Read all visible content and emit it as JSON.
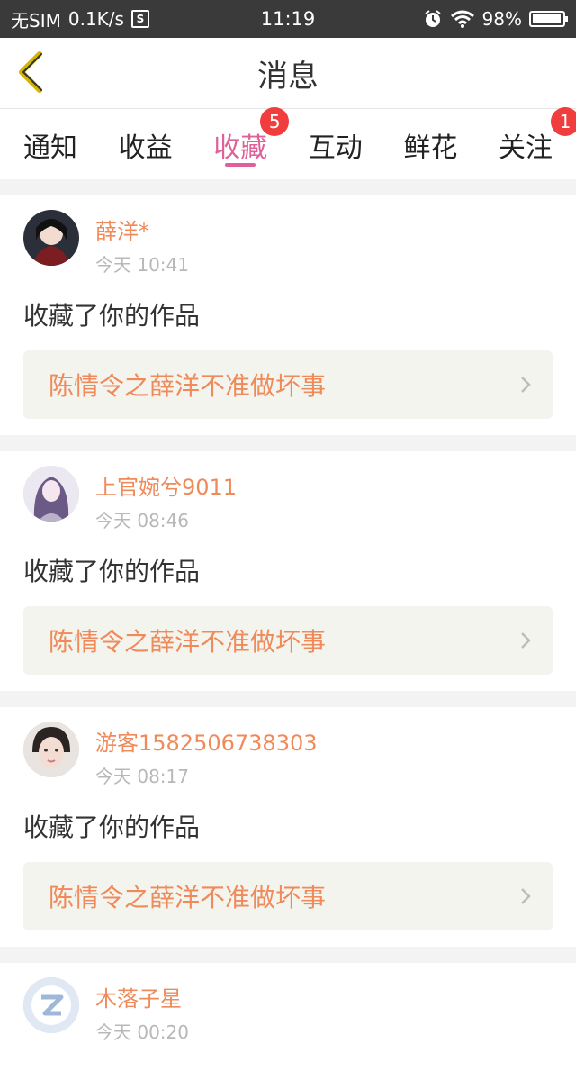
{
  "status_bar": {
    "carrier": "无SIM",
    "speed": "0.1K/s",
    "sim_icon_letter": "S",
    "time": "11:19",
    "battery": "98%",
    "battery_level": 0.98,
    "icons": [
      "alarm-icon",
      "wifi-icon",
      "battery-icon"
    ]
  },
  "header": {
    "title": "消息",
    "back_icon": "chevron-left-icon",
    "accent": "#d4b400"
  },
  "tabs": [
    {
      "label": "通知",
      "badge": ""
    },
    {
      "label": "收益",
      "badge": ""
    },
    {
      "label": "收藏",
      "badge": "5"
    },
    {
      "label": "互动",
      "badge": ""
    },
    {
      "label": "鲜花",
      "badge": ""
    },
    {
      "label": "关注",
      "badge": "1"
    }
  ],
  "active_tab": "收藏",
  "colors": {
    "accent_pink": "#e0609a",
    "name_orange": "#ef8a5a",
    "badge_red": "#f03e3e"
  },
  "messages": [
    {
      "name": "薛洋*",
      "time": "今天 10:41",
      "action": "收藏了你的作品",
      "work": "陈情令之薛洋不准做坏事"
    },
    {
      "name": "上官婉兮9011",
      "time": "今天 08:46",
      "action": "收藏了你的作品",
      "work": "陈情令之薛洋不准做坏事"
    },
    {
      "name": "游客1582506738303",
      "time": "今天 08:17",
      "action": "收藏了你的作品",
      "work": "陈情令之薛洋不准做坏事"
    },
    {
      "name": "木落子星",
      "time": "今天 00:20"
    }
  ]
}
